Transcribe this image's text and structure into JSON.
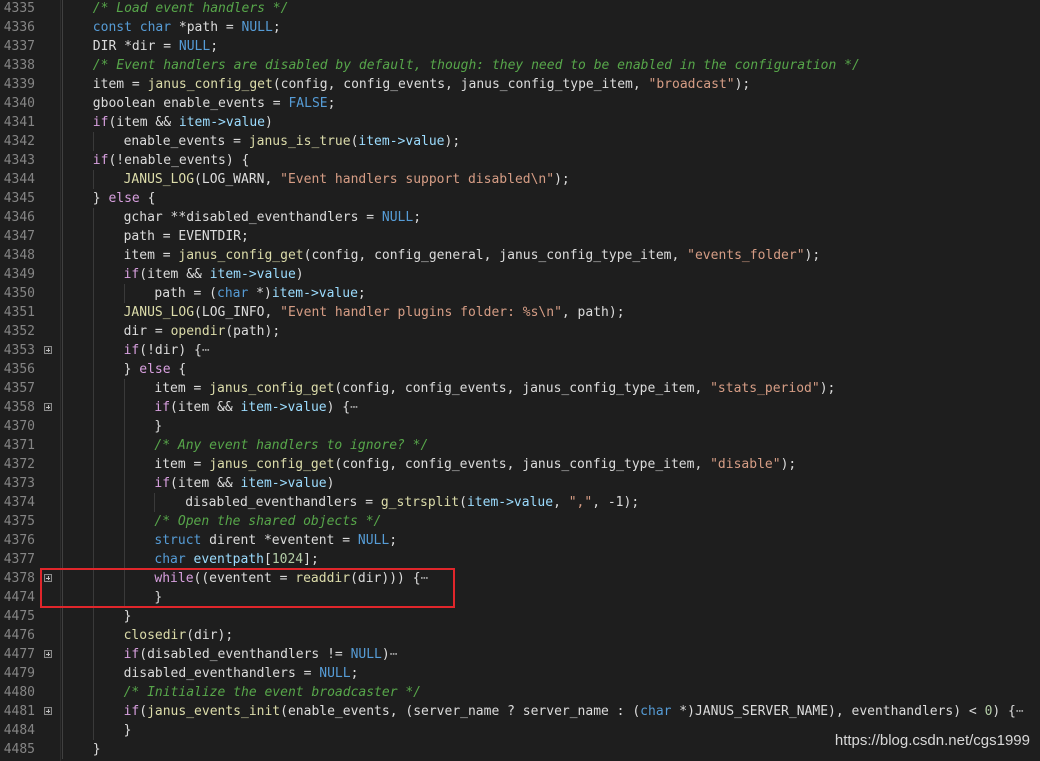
{
  "editor": {
    "lines": [
      {
        "num": "4335",
        "fold": false,
        "indent": 1,
        "tokens": [
          [
            "cmt",
            "/* Load event handlers */"
          ]
        ]
      },
      {
        "num": "4336",
        "fold": false,
        "indent": 1,
        "tokens": [
          [
            "kw",
            "const"
          ],
          [
            "plain",
            " "
          ],
          [
            "kw",
            "char"
          ],
          [
            "plain",
            " *path = "
          ],
          [
            "kw",
            "NULL"
          ],
          [
            "plain",
            ";"
          ]
        ]
      },
      {
        "num": "4337",
        "fold": false,
        "indent": 1,
        "tokens": [
          [
            "plain",
            "DIR *dir = "
          ],
          [
            "kw",
            "NULL"
          ],
          [
            "plain",
            ";"
          ]
        ]
      },
      {
        "num": "4338",
        "fold": false,
        "indent": 1,
        "tokens": [
          [
            "cmt",
            "/* Event handlers are disabled by default, though: they need to be enabled in the configuration */"
          ]
        ]
      },
      {
        "num": "4339",
        "fold": false,
        "indent": 1,
        "tokens": [
          [
            "plain",
            "item = "
          ],
          [
            "fn",
            "janus_config_get"
          ],
          [
            "plain",
            "(config, config_events, janus_config_type_item, "
          ],
          [
            "str",
            "\"broadcast\""
          ],
          [
            "plain",
            ");"
          ]
        ]
      },
      {
        "num": "4340",
        "fold": false,
        "indent": 1,
        "tokens": [
          [
            "plain",
            "gboolean enable_events = "
          ],
          [
            "kw",
            "FALSE"
          ],
          [
            "plain",
            ";"
          ]
        ]
      },
      {
        "num": "4341",
        "fold": false,
        "indent": 1,
        "tokens": [
          [
            "ctrl",
            "if"
          ],
          [
            "plain",
            "(item && "
          ],
          [
            "mem",
            "item->value"
          ],
          [
            "plain",
            ")"
          ]
        ]
      },
      {
        "num": "4342",
        "fold": false,
        "indent": 2,
        "tokens": [
          [
            "plain",
            "enable_events = "
          ],
          [
            "fn",
            "janus_is_true"
          ],
          [
            "plain",
            "("
          ],
          [
            "mem",
            "item->value"
          ],
          [
            "plain",
            ");"
          ]
        ]
      },
      {
        "num": "4343",
        "fold": false,
        "indent": 1,
        "tokens": [
          [
            "ctrl",
            "if"
          ],
          [
            "plain",
            "(!enable_events) {"
          ]
        ]
      },
      {
        "num": "4344",
        "fold": false,
        "indent": 2,
        "tokens": [
          [
            "fn",
            "JANUS_LOG"
          ],
          [
            "plain",
            "(LOG_WARN, "
          ],
          [
            "str",
            "\"Event handlers support disabled\\n\""
          ],
          [
            "plain",
            ");"
          ]
        ]
      },
      {
        "num": "4345",
        "fold": false,
        "indent": 1,
        "tokens": [
          [
            "plain",
            "} "
          ],
          [
            "ctrl",
            "else"
          ],
          [
            "plain",
            " {"
          ]
        ]
      },
      {
        "num": "4346",
        "fold": false,
        "indent": 2,
        "tokens": [
          [
            "plain",
            "gchar **disabled_eventhandlers = "
          ],
          [
            "kw",
            "NULL"
          ],
          [
            "plain",
            ";"
          ]
        ]
      },
      {
        "num": "4347",
        "fold": false,
        "indent": 2,
        "tokens": [
          [
            "plain",
            "path = EVENTDIR;"
          ]
        ]
      },
      {
        "num": "4348",
        "fold": false,
        "indent": 2,
        "tokens": [
          [
            "plain",
            "item = "
          ],
          [
            "fn",
            "janus_config_get"
          ],
          [
            "plain",
            "(config, config_general, janus_config_type_item, "
          ],
          [
            "str",
            "\"events_folder\""
          ],
          [
            "plain",
            ");"
          ]
        ]
      },
      {
        "num": "4349",
        "fold": false,
        "indent": 2,
        "tokens": [
          [
            "ctrl",
            "if"
          ],
          [
            "plain",
            "(item && "
          ],
          [
            "mem",
            "item->value"
          ],
          [
            "plain",
            ")"
          ]
        ]
      },
      {
        "num": "4350",
        "fold": false,
        "indent": 3,
        "tokens": [
          [
            "plain",
            "path = ("
          ],
          [
            "kw",
            "char"
          ],
          [
            "plain",
            " *)"
          ],
          [
            "mem",
            "item->value"
          ],
          [
            "plain",
            ";"
          ]
        ]
      },
      {
        "num": "4351",
        "fold": false,
        "indent": 2,
        "tokens": [
          [
            "fn",
            "JANUS_LOG"
          ],
          [
            "plain",
            "(LOG_INFO, "
          ],
          [
            "str",
            "\"Event handler plugins folder: %s\\n\""
          ],
          [
            "plain",
            ", path);"
          ]
        ]
      },
      {
        "num": "4352",
        "fold": false,
        "indent": 2,
        "tokens": [
          [
            "plain",
            "dir = "
          ],
          [
            "fn",
            "opendir"
          ],
          [
            "plain",
            "(path);"
          ]
        ]
      },
      {
        "num": "4353",
        "fold": true,
        "indent": 2,
        "tokens": [
          [
            "ctrl",
            "if"
          ],
          [
            "plain",
            "(!dir) {"
          ],
          [
            "ell",
            "⋯"
          ]
        ]
      },
      {
        "num": "4356",
        "fold": false,
        "indent": 2,
        "tokens": [
          [
            "plain",
            "} "
          ],
          [
            "ctrl",
            "else"
          ],
          [
            "plain",
            " {"
          ]
        ]
      },
      {
        "num": "4357",
        "fold": false,
        "indent": 3,
        "tokens": [
          [
            "plain",
            "item = "
          ],
          [
            "fn",
            "janus_config_get"
          ],
          [
            "plain",
            "(config, config_events, janus_config_type_item, "
          ],
          [
            "str",
            "\"stats_period\""
          ],
          [
            "plain",
            ");"
          ]
        ]
      },
      {
        "num": "4358",
        "fold": true,
        "indent": 3,
        "tokens": [
          [
            "ctrl",
            "if"
          ],
          [
            "plain",
            "(item && "
          ],
          [
            "mem",
            "item->value"
          ],
          [
            "plain",
            ") {"
          ],
          [
            "ell",
            "⋯"
          ]
        ]
      },
      {
        "num": "4370",
        "fold": false,
        "indent": 3,
        "tokens": [
          [
            "plain",
            "}"
          ]
        ]
      },
      {
        "num": "4371",
        "fold": false,
        "indent": 3,
        "tokens": [
          [
            "cmt",
            "/* Any event handlers to ignore? */"
          ]
        ]
      },
      {
        "num": "4372",
        "fold": false,
        "indent": 3,
        "tokens": [
          [
            "plain",
            "item = "
          ],
          [
            "fn",
            "janus_config_get"
          ],
          [
            "plain",
            "(config, config_events, janus_config_type_item, "
          ],
          [
            "str",
            "\"disable\""
          ],
          [
            "plain",
            ");"
          ]
        ]
      },
      {
        "num": "4373",
        "fold": false,
        "indent": 3,
        "tokens": [
          [
            "ctrl",
            "if"
          ],
          [
            "plain",
            "(item && "
          ],
          [
            "mem",
            "item->value"
          ],
          [
            "plain",
            ")"
          ]
        ]
      },
      {
        "num": "4374",
        "fold": false,
        "indent": 4,
        "tokens": [
          [
            "plain",
            "disabled_eventhandlers = "
          ],
          [
            "fn",
            "g_strsplit"
          ],
          [
            "plain",
            "("
          ],
          [
            "mem",
            "item->value"
          ],
          [
            "plain",
            ", "
          ],
          [
            "str",
            "\",\""
          ],
          [
            "plain",
            ", -1);"
          ]
        ]
      },
      {
        "num": "4375",
        "fold": false,
        "indent": 3,
        "tokens": [
          [
            "cmt",
            "/* Open the shared objects */"
          ]
        ]
      },
      {
        "num": "4376",
        "fold": false,
        "indent": 3,
        "tokens": [
          [
            "kw",
            "struct"
          ],
          [
            "plain",
            " dirent *eventent = "
          ],
          [
            "kw",
            "NULL"
          ],
          [
            "plain",
            ";"
          ]
        ]
      },
      {
        "num": "4377",
        "fold": false,
        "indent": 3,
        "tokens": [
          [
            "kw",
            "char"
          ],
          [
            "plain",
            " "
          ],
          [
            "mem",
            "eventpath"
          ],
          [
            "plain",
            "["
          ],
          [
            "num",
            "1024"
          ],
          [
            "plain",
            "];"
          ]
        ]
      },
      {
        "num": "4378",
        "fold": true,
        "indent": 3,
        "tokens": [
          [
            "ctrl",
            "while"
          ],
          [
            "plain",
            "((eventent = "
          ],
          [
            "fn",
            "readdir"
          ],
          [
            "plain",
            "(dir))) {"
          ],
          [
            "ell",
            "⋯"
          ]
        ]
      },
      {
        "num": "4474",
        "fold": false,
        "indent": 3,
        "tokens": [
          [
            "plain",
            "}"
          ]
        ]
      },
      {
        "num": "4475",
        "fold": false,
        "indent": 2,
        "tokens": [
          [
            "plain",
            "}"
          ]
        ]
      },
      {
        "num": "4476",
        "fold": false,
        "indent": 2,
        "tokens": [
          [
            "fn",
            "closedir"
          ],
          [
            "plain",
            "(dir);"
          ]
        ]
      },
      {
        "num": "4477",
        "fold": true,
        "indent": 2,
        "tokens": [
          [
            "ctrl",
            "if"
          ],
          [
            "plain",
            "(disabled_eventhandlers != "
          ],
          [
            "kw",
            "NULL"
          ],
          [
            "plain",
            ")"
          ],
          [
            "ell",
            "⋯"
          ]
        ]
      },
      {
        "num": "4479",
        "fold": false,
        "indent": 2,
        "tokens": [
          [
            "plain",
            "disabled_eventhandlers = "
          ],
          [
            "kw",
            "NULL"
          ],
          [
            "plain",
            ";"
          ]
        ]
      },
      {
        "num": "4480",
        "fold": false,
        "indent": 2,
        "tokens": [
          [
            "cmt",
            "/* Initialize the event broadcaster */"
          ]
        ]
      },
      {
        "num": "4481",
        "fold": true,
        "indent": 2,
        "tokens": [
          [
            "ctrl",
            "if"
          ],
          [
            "plain",
            "("
          ],
          [
            "fn",
            "janus_events_init"
          ],
          [
            "plain",
            "(enable_events, (server_name ? server_name : ("
          ],
          [
            "kw",
            "char"
          ],
          [
            "plain",
            " *)JANUS_SERVER_NAME), eventhandlers) < "
          ],
          [
            "num",
            "0"
          ],
          [
            "plain",
            ") {"
          ],
          [
            "ell",
            "⋯"
          ]
        ]
      },
      {
        "num": "4484",
        "fold": false,
        "indent": 2,
        "tokens": [
          [
            "plain",
            "}"
          ]
        ]
      },
      {
        "num": "4485",
        "fold": false,
        "indent": 1,
        "tokens": [
          [
            "plain",
            "}"
          ]
        ]
      }
    ]
  },
  "watermark": "https://blog.csdn.net/cgs1999",
  "colors": {
    "background": "#1e1e1e",
    "highlight_box": "#e0262b"
  }
}
